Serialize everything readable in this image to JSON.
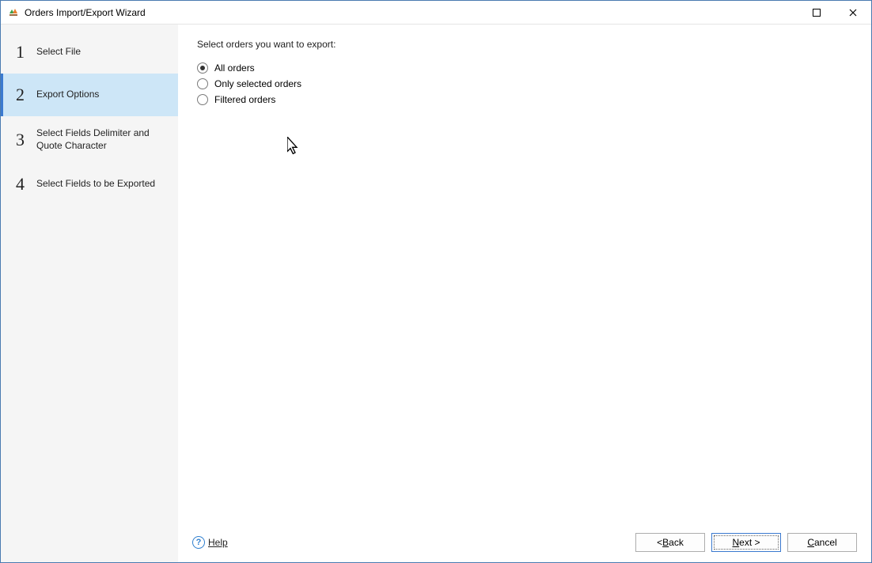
{
  "window": {
    "title": "Orders Import/Export Wizard"
  },
  "steps": [
    {
      "num": "1",
      "label": "Select File"
    },
    {
      "num": "2",
      "label": "Export Options"
    },
    {
      "num": "3",
      "label": "Select Fields Delimiter and Quote Character"
    },
    {
      "num": "4",
      "label": "Select Fields to be Exported"
    }
  ],
  "active_step": 1,
  "content": {
    "prompt": "Select orders you want to export:",
    "options": [
      {
        "label": "All orders",
        "selected": true
      },
      {
        "label": "Only selected orders",
        "selected": false
      },
      {
        "label": "Filtered orders",
        "selected": false
      }
    ]
  },
  "footer": {
    "help": "Help",
    "back_prefix": "< ",
    "back_mn": "B",
    "back_suffix": "ack",
    "next_mn": "N",
    "next_suffix": "ext >",
    "cancel_mn": "C",
    "cancel_suffix": "ancel"
  }
}
